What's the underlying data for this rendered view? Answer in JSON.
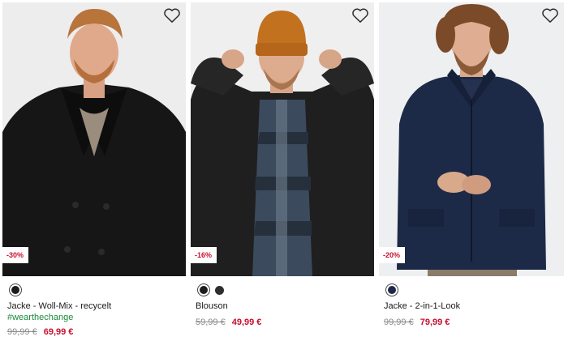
{
  "products": [
    {
      "discount": "-30%",
      "swatches": [
        "#1c1c1c"
      ],
      "name": "Jacke - Woll-Mix - recycelt",
      "tag": "#wearthechange",
      "old_price": "99,99 €",
      "new_price": "69,99 €"
    },
    {
      "discount": "-16%",
      "swatches": [
        "#1c1c1c",
        "#2e2e2e"
      ],
      "name": "Blouson",
      "old_price": "59,99 €",
      "new_price": "49,99 €"
    },
    {
      "discount": "-20%",
      "swatches": [
        "#1d2a47"
      ],
      "name": "Jacke - 2-in-1-Look",
      "old_price": "99,99 €",
      "new_price": "79,99 €"
    }
  ],
  "colors": {
    "sale_red": "#c8102e",
    "hashtag_green": "#1a8a3c",
    "old_price_gray": "#8a8a8a"
  },
  "icons": {
    "wishlist": "heart-outline-icon"
  }
}
